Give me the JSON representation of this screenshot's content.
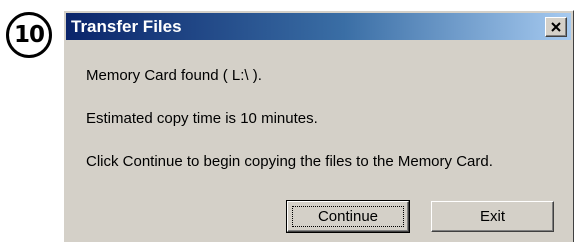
{
  "step": {
    "number": "10"
  },
  "dialog": {
    "title": "Transfer Files",
    "lines": [
      "Memory Card found ( L:\\ ).",
      "Estimated copy time is  10 minutes.",
      "Click Continue to begin copying the files to the Memory Card."
    ],
    "buttons": {
      "continue_label": "Continue",
      "exit_label": "Exit"
    }
  },
  "icons": {
    "close": "close-icon"
  },
  "colors": {
    "titlebar_start": "#0a246a",
    "titlebar_end": "#a6caf0",
    "dialog_face": "#d4d0c8"
  }
}
